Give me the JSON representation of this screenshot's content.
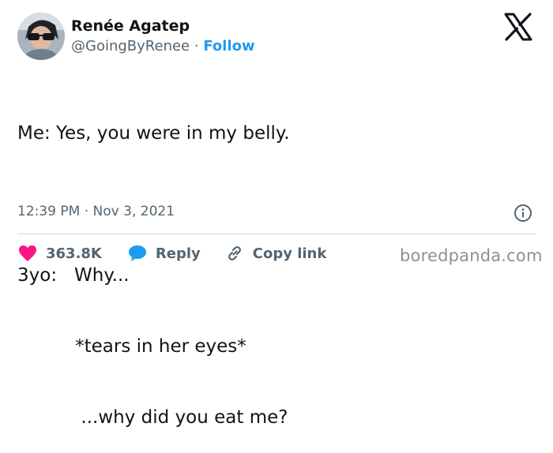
{
  "author": {
    "name": "Renée Agatep",
    "handle": "@GoingByRenee",
    "separator": "·",
    "follow_label": "Follow"
  },
  "tweet": {
    "lines": [
      "Me: Yes, you were in my belly.",
      "",
      "3yo:   Why...",
      "          *tears in her eyes*",
      "           ...why did you eat me?"
    ]
  },
  "meta": {
    "time": "12:39 PM",
    "separator": "·",
    "date": "Nov 3, 2021"
  },
  "actions": {
    "likes_count": "363.8K",
    "reply_label": "Reply",
    "copy_link_label": "Copy link"
  },
  "watermark": "boredpanda.com",
  "colors": {
    "like": "#f91880",
    "reply": "#1d9bf0",
    "follow": "#1d9bf0",
    "secondary_text": "#536471",
    "divider": "#cfd9de"
  },
  "icons": {
    "brand": "x-logo-icon",
    "info": "info-icon",
    "like": "heart-icon",
    "reply": "speech-bubble-icon",
    "copy_link": "link-icon"
  }
}
